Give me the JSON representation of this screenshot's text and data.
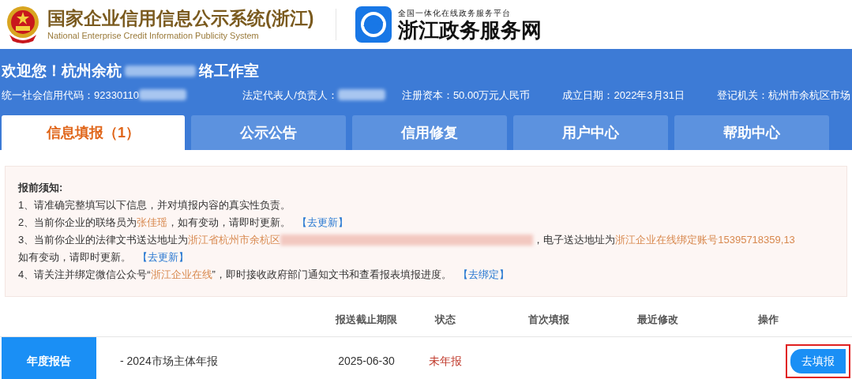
{
  "header": {
    "title": "国家企业信用信息公示系统(浙江)",
    "subtitle": "National Enterprise Credit Information Publicity System",
    "portal_tagline": "全国一体化在线政务服务平台",
    "portal_name": "浙江政务服务网"
  },
  "company": {
    "welcome_start": "欢迎您！杭州余杭",
    "welcome_end": "络工作室",
    "fields": [
      {
        "label": "统一社会信用代码：",
        "value": "92330110",
        "blurred": true
      },
      {
        "label": "法定代表人/负责人：",
        "blurred": true
      },
      {
        "label": "注册资本：",
        "value": "50.00万元人民币",
        "blurred": false
      },
      {
        "label": "成立日期：",
        "value": "2022年3月31日",
        "blurred": false
      },
      {
        "label": "登记机关：",
        "value": "杭州市余杭区市场",
        "blurred": false
      }
    ]
  },
  "tabs": [
    {
      "label": "信息填报（1）",
      "selected": true
    },
    {
      "label": "公示公告",
      "selected": false
    },
    {
      "label": "信用修复",
      "selected": false
    },
    {
      "label": "用户中心",
      "selected": false
    },
    {
      "label": "帮助中心",
      "selected": false
    }
  ],
  "notice": {
    "title": "报前须知:",
    "lines": [
      [
        {
          "kind": "text",
          "text": "1、请准确完整填写以下信息，并对填报内容的真实性负责。"
        }
      ],
      [
        {
          "kind": "text",
          "text": "2、当前你企业的联络员为 "
        },
        {
          "kind": "highlight",
          "text": "张佳瑶"
        },
        {
          "kind": "text",
          "text": " ，如有变动，请即时更新。"
        },
        {
          "kind": "link",
          "text": "【去更新】"
        }
      ],
      [
        {
          "kind": "text",
          "text": "3、当前你企业的法律文书送达地址为 "
        },
        {
          "kind": "highlight",
          "text": "浙江省杭州市余杭区"
        },
        {
          "kind": "blur"
        },
        {
          "kind": "text",
          "text": "，电子送达地址为 "
        },
        {
          "kind": "highlight",
          "text": "浙江企业在线绑定账号15395718359,13"
        }
      ],
      [
        {
          "kind": "text",
          "text": "如有变动，请即时更新。"
        },
        {
          "kind": "link",
          "text": "【去更新】"
        }
      ],
      [
        {
          "kind": "text",
          "text": "4、请关注并绑定微信公众号“"
        },
        {
          "kind": "highlight",
          "text": "浙江企业在线"
        },
        {
          "kind": "text",
          "text": "”，即时接收政府部门通知文书和查看报表填报进度。"
        },
        {
          "kind": "link",
          "text": "【去绑定】"
        }
      ]
    ]
  },
  "table": {
    "columns": [
      "报送截止期限",
      "状态",
      "首次填报",
      "最近修改",
      "操作"
    ],
    "rows": [
      {
        "category": "年度报告",
        "name": "- 2024市场主体年报",
        "deadline": "2025-06-30",
        "status": "未年报",
        "action": "去填报",
        "highlighted": true
      }
    ]
  }
}
